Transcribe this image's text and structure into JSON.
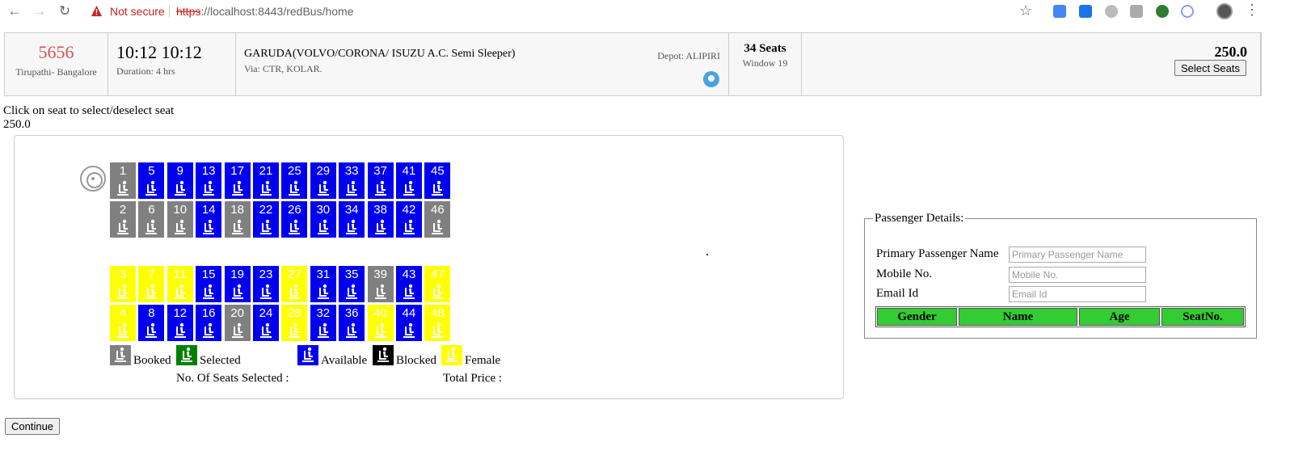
{
  "browser": {
    "not_secure": "Not secure",
    "url_scheme": "https",
    "url_rest": "://localhost:8443/redBus/home"
  },
  "bus": {
    "number": "5656",
    "route": "Tirupathi- Bangalore",
    "times": "10:12 10:12",
    "duration": "Duration: 4 hrs",
    "name": "GARUDA(VOLVO/CORONA/ ISUZU A.C. Semi Sleeper)",
    "via": "Via: CTR, KOLAR.",
    "depot": "Depot: ALIPIRI",
    "seats": "34 Seats",
    "window": "Window 19",
    "price": "250.0",
    "select_seats_label": "Select Seats"
  },
  "hint": "Click on seat to select/deselect seat",
  "fare": "250.0",
  "seat_rows": [
    [
      {
        "n": "1",
        "s": "booked"
      },
      {
        "n": "5",
        "s": "available"
      },
      {
        "n": "9",
        "s": "available"
      },
      {
        "n": "13",
        "s": "available"
      },
      {
        "n": "17",
        "s": "available"
      },
      {
        "n": "21",
        "s": "available"
      },
      {
        "n": "25",
        "s": "available"
      },
      {
        "n": "29",
        "s": "available"
      },
      {
        "n": "33",
        "s": "available"
      },
      {
        "n": "37",
        "s": "available"
      },
      {
        "n": "41",
        "s": "available"
      },
      {
        "n": "45",
        "s": "available"
      }
    ],
    [
      {
        "n": "2",
        "s": "booked"
      },
      {
        "n": "6",
        "s": "booked"
      },
      {
        "n": "10",
        "s": "booked"
      },
      {
        "n": "14",
        "s": "available"
      },
      {
        "n": "18",
        "s": "booked"
      },
      {
        "n": "22",
        "s": "available"
      },
      {
        "n": "26",
        "s": "available"
      },
      {
        "n": "30",
        "s": "available"
      },
      {
        "n": "34",
        "s": "available"
      },
      {
        "n": "38",
        "s": "available"
      },
      {
        "n": "42",
        "s": "available"
      },
      {
        "n": "46",
        "s": "booked"
      }
    ],
    [
      {
        "n": "3",
        "s": "female"
      },
      {
        "n": "7",
        "s": "female"
      },
      {
        "n": "11",
        "s": "female"
      },
      {
        "n": "15",
        "s": "available"
      },
      {
        "n": "19",
        "s": "available"
      },
      {
        "n": "23",
        "s": "available"
      },
      {
        "n": "27",
        "s": "female"
      },
      {
        "n": "31",
        "s": "available"
      },
      {
        "n": "35",
        "s": "available"
      },
      {
        "n": "39",
        "s": "booked"
      },
      {
        "n": "43",
        "s": "available"
      },
      {
        "n": "47",
        "s": "female"
      }
    ],
    [
      {
        "n": "4",
        "s": "female"
      },
      {
        "n": "8",
        "s": "available"
      },
      {
        "n": "12",
        "s": "available"
      },
      {
        "n": "16",
        "s": "available"
      },
      {
        "n": "20",
        "s": "booked"
      },
      {
        "n": "24",
        "s": "available"
      },
      {
        "n": "28",
        "s": "female"
      },
      {
        "n": "32",
        "s": "available"
      },
      {
        "n": "36",
        "s": "available"
      },
      {
        "n": "40",
        "s": "female"
      },
      {
        "n": "44",
        "s": "available"
      },
      {
        "n": "48",
        "s": "female"
      }
    ]
  ],
  "legend": {
    "booked": "Booked",
    "selected": "Selected",
    "available": "Available",
    "blocked": "Blocked",
    "female": "Female"
  },
  "summary": {
    "seats_selected": "No. Of Seats Selected :",
    "total_price": "Total Price :"
  },
  "passenger": {
    "legend": "Passenger Details:",
    "primary_label": "Primary Passenger Name",
    "primary_placeholder": "Primary Passenger Name",
    "mobile_label": "Mobile No.",
    "mobile_placeholder": "Mobile No.",
    "email_label": "Email Id",
    "email_placeholder": "Email Id",
    "columns": [
      "Gender",
      "Name",
      "Age",
      "SeatNo."
    ]
  },
  "continue_label": "Continue",
  "colors": {
    "booked": "#808080",
    "available": "#0000ee",
    "female": "#ffff00",
    "selected": "#008000",
    "blocked": "#000000",
    "table_header": "#33cc33",
    "bus_number": "#d84f57"
  }
}
